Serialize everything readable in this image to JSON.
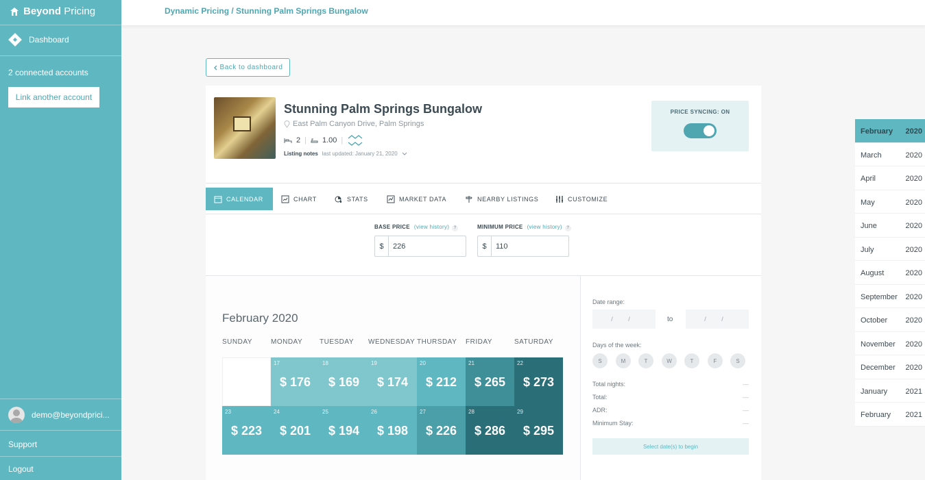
{
  "sidebar": {
    "logo_bold": "Beyond",
    "logo_light": "Pricing",
    "dashboard": "Dashboard",
    "accounts": "2 connected accounts",
    "link_account": "Link another account",
    "user_email": "demo@beyondprici...",
    "support": "Support",
    "logout": "Logout"
  },
  "header": {
    "breadcrumb": "Dynamic Pricing / Stunning Palm Springs Bungalow"
  },
  "back_button": "Back to dashboard",
  "listing": {
    "title": "Stunning Palm Springs Bungalow",
    "address": "East Palm Canyon Drive, Palm Springs",
    "bedrooms": "2",
    "bathrooms": "1.00",
    "notes_label": "Listing notes",
    "notes_updated": "last updated: January 21, 2020"
  },
  "sync": {
    "label": "PRICE SYNCING: ON",
    "on": true
  },
  "tabs": [
    {
      "label": "CALENDAR",
      "icon": "calendar-icon"
    },
    {
      "label": "CHART",
      "icon": "chart-icon"
    },
    {
      "label": "STATS",
      "icon": "stats-icon"
    },
    {
      "label": "MARKET DATA",
      "icon": "market-data-icon"
    },
    {
      "label": "NEARBY LISTINGS",
      "icon": "signpost-icon"
    },
    {
      "label": "CUSTOMIZE",
      "icon": "sliders-icon"
    }
  ],
  "pricing": {
    "base_label": "BASE PRICE",
    "min_label": "MINIMUM PRICE",
    "history_link": "(view history)",
    "help": "?",
    "currency": "$",
    "base_value": "226",
    "min_value": "110"
  },
  "calendar": {
    "month_title": "February 2020",
    "weekdays": [
      "SUNDAY",
      "MONDAY",
      "TUESDAY",
      "WEDNESDAY",
      "THURSDAY",
      "FRIDAY",
      "SATURDAY"
    ],
    "week1": [
      {
        "day": "",
        "price": "",
        "color": "empty"
      },
      {
        "day": "17",
        "price": "$ 176",
        "color": "#7fc6cd"
      },
      {
        "day": "18",
        "price": "$ 169",
        "color": "#7fc6cd"
      },
      {
        "day": "19",
        "price": "$ 174",
        "color": "#7fc6cd"
      },
      {
        "day": "20",
        "price": "$ 212",
        "color": "#5fb7c1"
      },
      {
        "day": "21",
        "price": "$ 265",
        "color": "#3f8f99"
      },
      {
        "day": "22",
        "price": "$ 273",
        "color": "#2a6e78"
      }
    ],
    "week2": [
      {
        "day": "23",
        "price": "$ 223",
        "color": "#5fb7c1"
      },
      {
        "day": "24",
        "price": "$ 201",
        "color": "#5fb7c1"
      },
      {
        "day": "25",
        "price": "$ 194",
        "color": "#5fb7c1"
      },
      {
        "day": "26",
        "price": "$ 198",
        "color": "#5fb7c1"
      },
      {
        "day": "27",
        "price": "$ 226",
        "color": "#4a9fa9"
      },
      {
        "day": "28",
        "price": "$ 286",
        "color": "#2a6e78"
      },
      {
        "day": "29",
        "price": "$ 295",
        "color": "#2a6e78"
      }
    ]
  },
  "filters": {
    "date_range_label": "Date range:",
    "date_placeholder": "/ /",
    "to": "to",
    "days_label": "Days of the week:",
    "days": [
      "S",
      "M",
      "T",
      "W",
      "T",
      "F",
      "S"
    ],
    "stats": [
      {
        "label": "Total nights:",
        "value": "—"
      },
      {
        "label": "Total:",
        "value": "—"
      },
      {
        "label": "ADR:",
        "value": "—"
      },
      {
        "label": "Minimum Stay:",
        "value": "—"
      }
    ],
    "select_prompt": "Select date(s) to begin"
  },
  "month_picker": [
    {
      "month": "February",
      "year": "2020",
      "active": true
    },
    {
      "month": "March",
      "year": "2020"
    },
    {
      "month": "April",
      "year": "2020"
    },
    {
      "month": "May",
      "year": "2020"
    },
    {
      "month": "June",
      "year": "2020"
    },
    {
      "month": "July",
      "year": "2020"
    },
    {
      "month": "August",
      "year": "2020"
    },
    {
      "month": "September",
      "year": "2020"
    },
    {
      "month": "October",
      "year": "2020"
    },
    {
      "month": "November",
      "year": "2020"
    },
    {
      "month": "December",
      "year": "2020"
    },
    {
      "month": "January",
      "year": "2021"
    },
    {
      "month": "February",
      "year": "2021"
    }
  ],
  "colors": {
    "accent": "#5fb7c1",
    "accent_dark": "#2a6e78"
  }
}
